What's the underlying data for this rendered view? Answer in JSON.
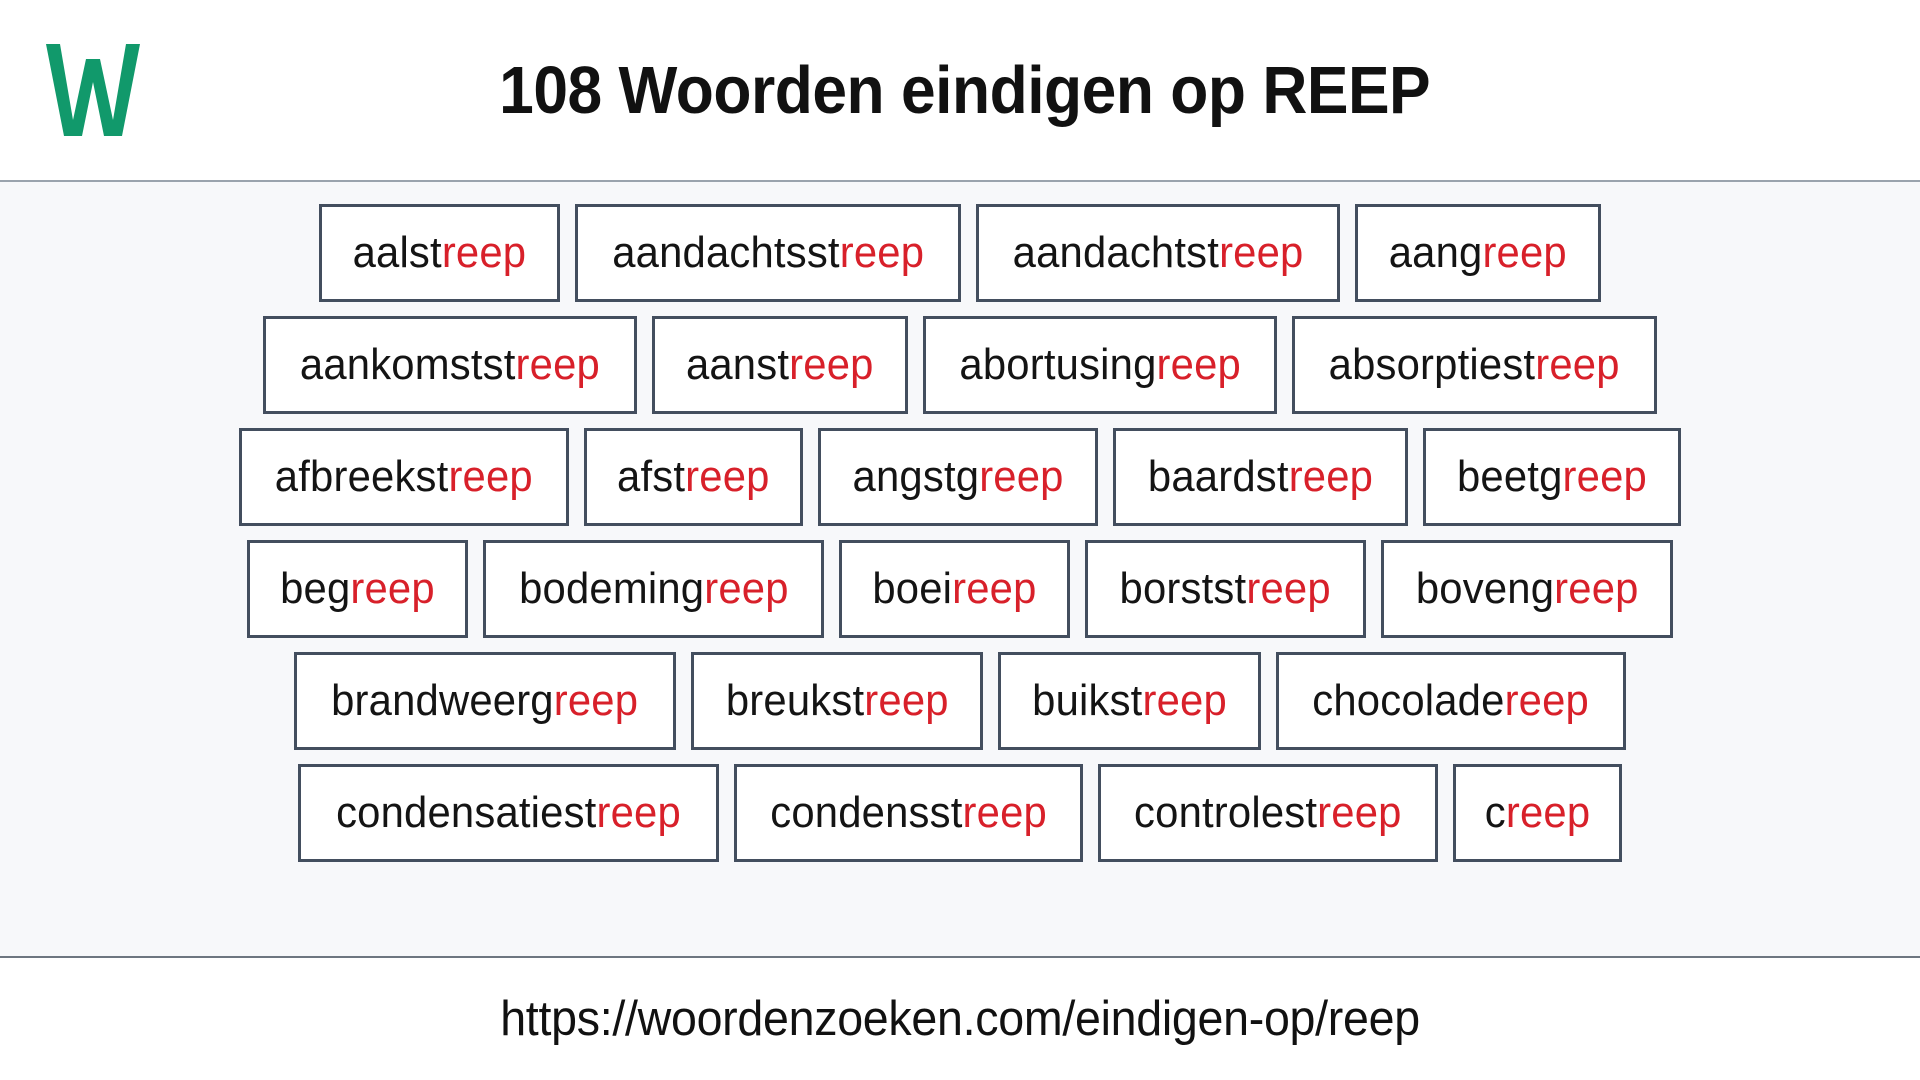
{
  "header": {
    "logo_icon": "w-logo-icon",
    "logo_letter": "W",
    "logo_color": "#11996b",
    "title": "108 Woorden eindigen op REEP"
  },
  "theme": {
    "page_background": "#f7f8fa",
    "box_background": "#ffffff",
    "box_border": "#434e5e",
    "text_color": "#141414",
    "highlight_color": "#d8202a",
    "accent_green": "#11996b"
  },
  "main": {
    "suffix": "reep",
    "rows": [
      {
        "words": [
          {
            "prefix": "aalst",
            "suffix": "reep"
          },
          {
            "prefix": "aandachtsst",
            "suffix": "reep"
          },
          {
            "prefix": "aandachtst",
            "suffix": "reep"
          },
          {
            "prefix": "aang",
            "suffix": "reep"
          }
        ]
      },
      {
        "words": [
          {
            "prefix": "aankomstst",
            "suffix": "reep"
          },
          {
            "prefix": "aanst",
            "suffix": "reep"
          },
          {
            "prefix": "abortusing",
            "suffix": "reep"
          },
          {
            "prefix": "absorptiest",
            "suffix": "reep"
          }
        ]
      },
      {
        "words": [
          {
            "prefix": "afbreekst",
            "suffix": "reep"
          },
          {
            "prefix": "afst",
            "suffix": "reep"
          },
          {
            "prefix": "angstg",
            "suffix": "reep"
          },
          {
            "prefix": "baardst",
            "suffix": "reep"
          },
          {
            "prefix": "beetg",
            "suffix": "reep"
          }
        ]
      },
      {
        "words": [
          {
            "prefix": "beg",
            "suffix": "reep"
          },
          {
            "prefix": "bodeming",
            "suffix": "reep"
          },
          {
            "prefix": "boei",
            "suffix": "reep"
          },
          {
            "prefix": "borstst",
            "suffix": "reep"
          },
          {
            "prefix": "boveng",
            "suffix": "reep"
          }
        ]
      },
      {
        "words": [
          {
            "prefix": "brandweerg",
            "suffix": "reep"
          },
          {
            "prefix": "breukst",
            "suffix": "reep"
          },
          {
            "prefix": "buikst",
            "suffix": "reep"
          },
          {
            "prefix": "chocolade",
            "suffix": "reep"
          }
        ]
      },
      {
        "words": [
          {
            "prefix": "condensatiest",
            "suffix": "reep"
          },
          {
            "prefix": "condensst",
            "suffix": "reep"
          },
          {
            "prefix": "controlest",
            "suffix": "reep"
          },
          {
            "prefix": "c",
            "suffix": "reep"
          }
        ]
      }
    ]
  },
  "footer": {
    "url": "https://woordenzoeken.com/eindigen-op/reep"
  }
}
